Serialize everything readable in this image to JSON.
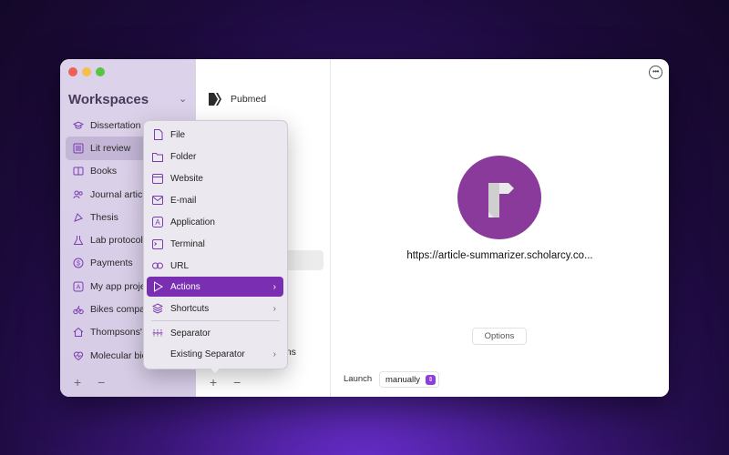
{
  "workspaces": {
    "title": "Workspaces",
    "items": [
      {
        "label": "Dissertation",
        "icon": "graduation-cap-icon"
      },
      {
        "label": "Lit review",
        "icon": "list-icon"
      },
      {
        "label": "Books",
        "icon": "books-icon"
      },
      {
        "label": "Journal articles",
        "icon": "people-icon"
      },
      {
        "label": "Thesis",
        "icon": "thesis-icon"
      },
      {
        "label": "Lab protocols",
        "icon": "flask-icon"
      },
      {
        "label": "Payments",
        "icon": "dollar-icon"
      },
      {
        "label": "My app projects",
        "icon": "app-icon"
      },
      {
        "label": "Bikes company",
        "icon": "bike-icon"
      },
      {
        "label": "Thompsons' house",
        "icon": "house-icon"
      },
      {
        "label": "Molecular biology",
        "icon": "heart-pulse-icon"
      }
    ],
    "active_index": 1,
    "add_label": "+",
    "remove_label": "−"
  },
  "middle": {
    "items": [
      {
        "label": "Pubmed",
        "icon": "pubmed-icon"
      },
      {
        "label": "ons",
        "icon": ""
      }
    ],
    "add_label": "+",
    "remove_label": "−"
  },
  "menu": {
    "items": [
      {
        "label": "File",
        "icon": "file-icon",
        "submenu": false
      },
      {
        "label": "Folder",
        "icon": "folder-icon",
        "submenu": false
      },
      {
        "label": "Website",
        "icon": "website-icon",
        "submenu": false
      },
      {
        "label": "E-mail",
        "icon": "email-icon",
        "submenu": false
      },
      {
        "label": "Application",
        "icon": "application-icon",
        "submenu": false
      },
      {
        "label": "Terminal",
        "icon": "terminal-icon",
        "submenu": false
      },
      {
        "label": "URL",
        "icon": "link-icon",
        "submenu": false
      },
      {
        "label": "Actions",
        "icon": "play-icon",
        "submenu": true
      },
      {
        "label": "Shortcuts",
        "icon": "shortcuts-icon",
        "submenu": true
      },
      {
        "label": "Separator",
        "icon": "separator-icon",
        "submenu": false
      },
      {
        "label": "Existing Separator",
        "icon": "",
        "submenu": true
      }
    ],
    "highlighted_index": 7
  },
  "detail": {
    "url": "https://article-summarizer.scholarcy.co...",
    "options_label": "Options",
    "launch_label": "Launch",
    "launch_value": "manually",
    "logo_color": "#8a3a9a"
  },
  "colors": {
    "accent": "#7a2fb2",
    "sidebar_bg": "#dcd2ea"
  }
}
